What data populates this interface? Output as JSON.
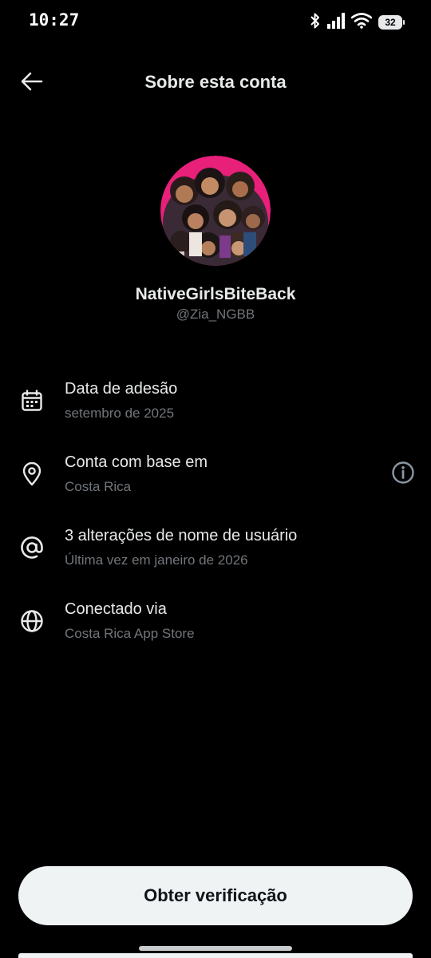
{
  "status_bar": {
    "time": "10:27",
    "battery": "32",
    "icons": [
      "bluetooth-icon",
      "signal-icon",
      "wifi-icon",
      "battery-icon"
    ]
  },
  "header": {
    "back_icon": "arrow-left-icon",
    "title": "Sobre esta conta"
  },
  "profile": {
    "avatar": "profile-avatar-image",
    "name": "NativeGirlsBiteBack",
    "handle": "@Zia_NGBB"
  },
  "details": [
    {
      "icon": "calendar-icon",
      "title": "Data de adesão",
      "subtitle": "setembro de 2025"
    },
    {
      "icon": "location-pin-icon",
      "title": "Conta com base em",
      "subtitle": "Costa Rica",
      "action_icon": "info-circle-icon"
    },
    {
      "icon": "at-sign-icon",
      "title": "3 alterações de nome de usuário",
      "subtitle": "Última vez em janeiro de 2026"
    },
    {
      "icon": "globe-icon",
      "title": "Conectado via",
      "subtitle": "Costa Rica App Store"
    }
  ],
  "footer": {
    "verify_label": "Obter verificação"
  },
  "colors": {
    "background": "#000000",
    "primary_text": "#e7e9ea",
    "secondary_text": "#71767b",
    "button_bg": "#eff3f4",
    "button_text": "#0f1419",
    "avatar_ring": "#e8207a"
  }
}
